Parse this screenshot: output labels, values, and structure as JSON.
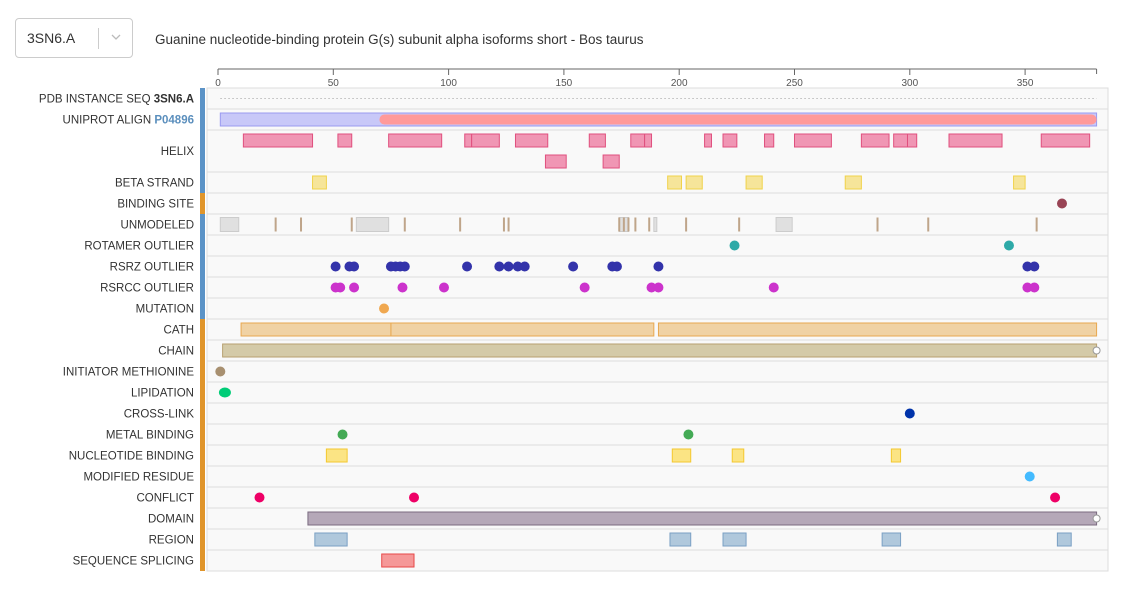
{
  "selector": {
    "value": "3SN6.A",
    "icon": "chevron-down-icon"
  },
  "title": "Guanine nucleotide-binding protein G(s) subunit alpha isoforms short - Bos taurus",
  "chart_data": {
    "type": "feature-track",
    "title": "Guanine nucleotide-binding protein G(s) subunit alpha isoforms short - Bos taurus",
    "x_axis": {
      "range": [
        0,
        381
      ],
      "ticks": [
        0,
        50,
        100,
        150,
        200,
        250,
        300,
        350
      ]
    },
    "group_colors": {
      "pdb": "#5b93c7",
      "uniprot": "#e0952b"
    },
    "tracks": [
      {
        "label": "PDB INSTANCE SEQ",
        "label_suffix": "3SN6.A",
        "suffix_style": "bold",
        "group": "pdb",
        "type": "dotted-line",
        "range": [
          1,
          381
        ]
      },
      {
        "label": "UNIPROT ALIGN",
        "label_suffix": "P04896",
        "suffix_style": "link",
        "group": "pdb",
        "type": "align",
        "color": "#c8c8f8",
        "stroke": "#9a9af0",
        "range": [
          1,
          381
        ],
        "overlay": {
          "color": "#ff9a9a",
          "range": [
            70,
            381
          ]
        }
      },
      {
        "label": "HELIX",
        "group": "pdb",
        "type": "blocks",
        "color": "#f096b4",
        "stroke": "#e0507e",
        "rows": 2,
        "features": [
          [
            11,
            41,
            0
          ],
          [
            52,
            58,
            0
          ],
          [
            74,
            97,
            0
          ],
          [
            107,
            110,
            0
          ],
          [
            110,
            122,
            0
          ],
          [
            129,
            143,
            0
          ],
          [
            161,
            168,
            0
          ],
          [
            179,
            185,
            0
          ],
          [
            185,
            188,
            0
          ],
          [
            211,
            214,
            0
          ],
          [
            219,
            225,
            0
          ],
          [
            237,
            241,
            0
          ],
          [
            250,
            266,
            0
          ],
          [
            279,
            291,
            0
          ],
          [
            293,
            299,
            0
          ],
          [
            299,
            303,
            0
          ],
          [
            317,
            340,
            0
          ],
          [
            357,
            378,
            0
          ],
          [
            142,
            151,
            1
          ],
          [
            167,
            174,
            1
          ]
        ]
      },
      {
        "label": "BETA STRAND",
        "group": "pdb",
        "type": "blocks",
        "color": "#f6e59a",
        "stroke": "#f0d24a",
        "features": [
          [
            41,
            47
          ],
          [
            195,
            201
          ],
          [
            203,
            210
          ],
          [
            229,
            236
          ],
          [
            272,
            279
          ],
          [
            345,
            350
          ]
        ]
      },
      {
        "label": "BINDING SITE",
        "group": "uniprot",
        "type": "points",
        "color": "#994455",
        "positions": [
          366
        ]
      },
      {
        "label": "UNMODELED",
        "group": "pdb",
        "type": "unmodeled",
        "box_color": "#e0e0e0",
        "box_stroke": "#cccccc",
        "tick_color": "#bfa58a",
        "boxes": [
          [
            1,
            9
          ],
          [
            60,
            74
          ],
          [
            174,
            178
          ],
          [
            189,
            190
          ],
          [
            242,
            249
          ]
        ],
        "ticks": [
          25,
          36,
          58,
          81,
          105,
          124,
          126,
          174,
          176,
          178,
          181,
          187,
          203,
          226,
          286,
          308,
          355
        ]
      },
      {
        "label": "ROTAMER OUTLIER",
        "group": "pdb",
        "type": "points",
        "color": "#2eaaa8",
        "positions": [
          224,
          343
        ]
      },
      {
        "label": "RSRZ OUTLIER",
        "group": "pdb",
        "type": "points",
        "color": "#3333aa",
        "positions": [
          51,
          57,
          59,
          75,
          77,
          79,
          81,
          108,
          122,
          126,
          130,
          133,
          154,
          171,
          173,
          191,
          351,
          354
        ]
      },
      {
        "label": "RSRCC OUTLIER",
        "group": "pdb",
        "type": "points",
        "color": "#cc33cc",
        "positions": [
          51,
          53,
          59,
          80,
          98,
          159,
          188,
          191,
          241,
          351,
          354
        ]
      },
      {
        "label": "MUTATION",
        "group": "pdb",
        "type": "points",
        "color": "#f0a850",
        "positions": [
          72
        ]
      },
      {
        "label": "CATH",
        "group": "uniprot",
        "type": "blocks",
        "color": "#f0d2a4",
        "stroke": "#e8a850",
        "features": [
          [
            10,
            75
          ],
          [
            75,
            189
          ],
          [
            191,
            381
          ]
        ]
      },
      {
        "label": "CHAIN",
        "group": "uniprot",
        "type": "bar",
        "color": "#d4caa8",
        "stroke": "#b8a070",
        "range": [
          2,
          381
        ],
        "open_end": true
      },
      {
        "label": "INITIATOR METHIONINE",
        "group": "uniprot",
        "type": "points",
        "color": "#a89070",
        "positions": [
          1
        ]
      },
      {
        "label": "LIPIDATION",
        "group": "uniprot",
        "type": "points",
        "color": "#00cc77",
        "positions": [
          3
        ],
        "wide": true
      },
      {
        "label": "CROSS-LINK",
        "group": "uniprot",
        "type": "points",
        "color": "#0033aa",
        "positions": [
          300
        ]
      },
      {
        "label": "METAL BINDING",
        "group": "uniprot",
        "type": "points",
        "color": "#44aa55",
        "positions": [
          54,
          204
        ]
      },
      {
        "label": "NUCLEOTIDE BINDING",
        "group": "uniprot",
        "type": "blocks",
        "color": "#fbe484",
        "stroke": "#f4c830",
        "features": [
          [
            47,
            56
          ],
          [
            197,
            205
          ],
          [
            223,
            228
          ],
          [
            292,
            296
          ]
        ]
      },
      {
        "label": "MODIFIED RESIDUE",
        "group": "uniprot",
        "type": "points",
        "color": "#44bbff",
        "positions": [
          352
        ]
      },
      {
        "label": "CONFLICT",
        "group": "uniprot",
        "type": "points",
        "color": "#ee0066",
        "positions": [
          18,
          85,
          363
        ]
      },
      {
        "label": "DOMAIN",
        "group": "uniprot",
        "type": "bar",
        "color": "#b5a8b8",
        "stroke": "#7a6a80",
        "range": [
          39,
          381
        ],
        "open_end": true
      },
      {
        "label": "REGION",
        "group": "uniprot",
        "type": "blocks",
        "color": "#b0c8dc",
        "stroke": "#7aa0c4",
        "features": [
          [
            42,
            56
          ],
          [
            196,
            205
          ],
          [
            219,
            229
          ],
          [
            288,
            296
          ],
          [
            364,
            370
          ]
        ]
      },
      {
        "label": "SEQUENCE SPLICING",
        "group": "uniprot",
        "type": "blocks",
        "color": "#f59898",
        "stroke": "#e84848",
        "features": [
          [
            71,
            85
          ]
        ]
      }
    ]
  }
}
